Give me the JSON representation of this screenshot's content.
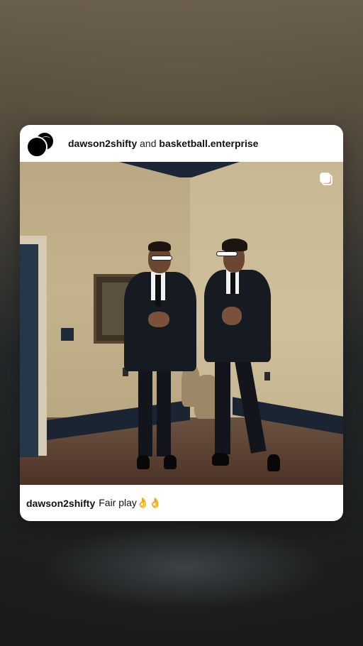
{
  "post": {
    "author": "dawson2shifty",
    "connector": "and",
    "collaborator": "basketball.enterprise"
  },
  "caption": {
    "username": "dawson2shifty",
    "text": "Fair play👌👌"
  },
  "icons": {
    "avatar": "profile-avatar",
    "multi": "multiple-posts-icon"
  },
  "colors": {
    "card_background": "#ffffff",
    "text": "#111111"
  }
}
